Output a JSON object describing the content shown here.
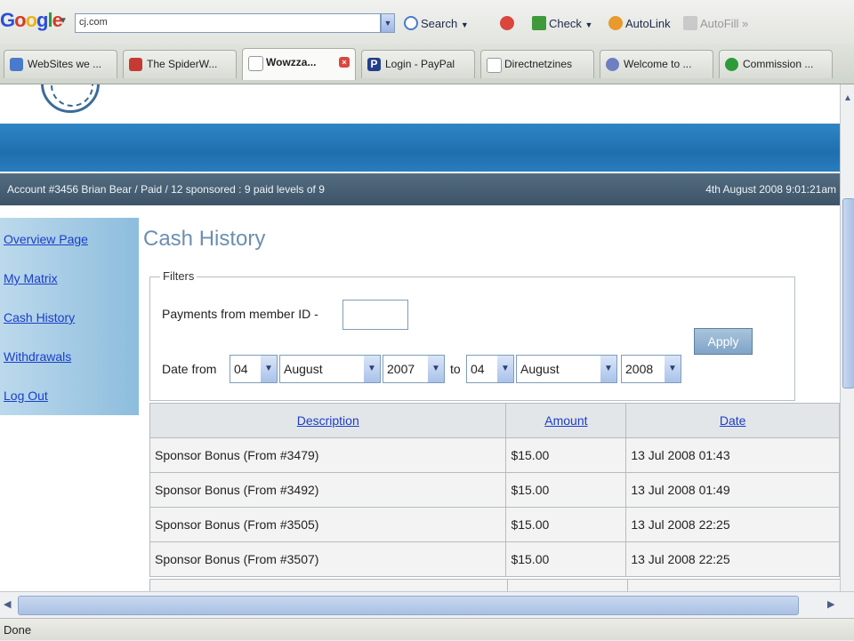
{
  "toolbar": {
    "search_value": "cj.com",
    "search_label": "Search",
    "check_label": "Check",
    "autolink_label": "AutoLink",
    "autofill_label": "AutoFill"
  },
  "tabs": [
    {
      "label": "WebSites we ..."
    },
    {
      "label": "The SpiderW..."
    },
    {
      "label": "Wowzza..."
    },
    {
      "label": "Login - PayPal"
    },
    {
      "label": "Directnetzines"
    },
    {
      "label": "Welcome to ..."
    },
    {
      "label": "Commission ..."
    }
  ],
  "account_bar": {
    "left": "Account #3456 Brian Bear / Paid / 12 sponsored : 9 paid levels of 9",
    "right": "4th August 2008 9:01:21am"
  },
  "sidebar": {
    "items": [
      {
        "label": "Overview Page"
      },
      {
        "label": "My Matrix"
      },
      {
        "label": "Cash History"
      },
      {
        "label": "Withdrawals"
      },
      {
        "label": "Log Out"
      }
    ]
  },
  "main": {
    "title": "Cash History",
    "filters_legend": "Filters",
    "member_label": "Payments from member ID -",
    "member_value": "",
    "date_from_label": "Date from",
    "to_label": "to",
    "apply_label": "Apply",
    "from": {
      "day": "04",
      "month": "August",
      "year": "2007"
    },
    "to": {
      "day": "04",
      "month": "August",
      "year": "2008"
    }
  },
  "table": {
    "headers": {
      "description": "Description",
      "amount": "Amount",
      "date": "Date"
    },
    "rows": [
      {
        "description": "Sponsor Bonus (From #3479)",
        "amount": "$15.00",
        "date": "13 Jul 2008 01:43"
      },
      {
        "description": "Sponsor Bonus (From #3492)",
        "amount": "$15.00",
        "date": "13 Jul 2008 01:49"
      },
      {
        "description": "Sponsor Bonus (From #3505)",
        "amount": "$15.00",
        "date": "13 Jul 2008 22:25"
      },
      {
        "description": "Sponsor Bonus (From #3507)",
        "amount": "$15.00",
        "date": "13 Jul 2008 22:25"
      }
    ]
  },
  "status": {
    "text": "Done"
  }
}
